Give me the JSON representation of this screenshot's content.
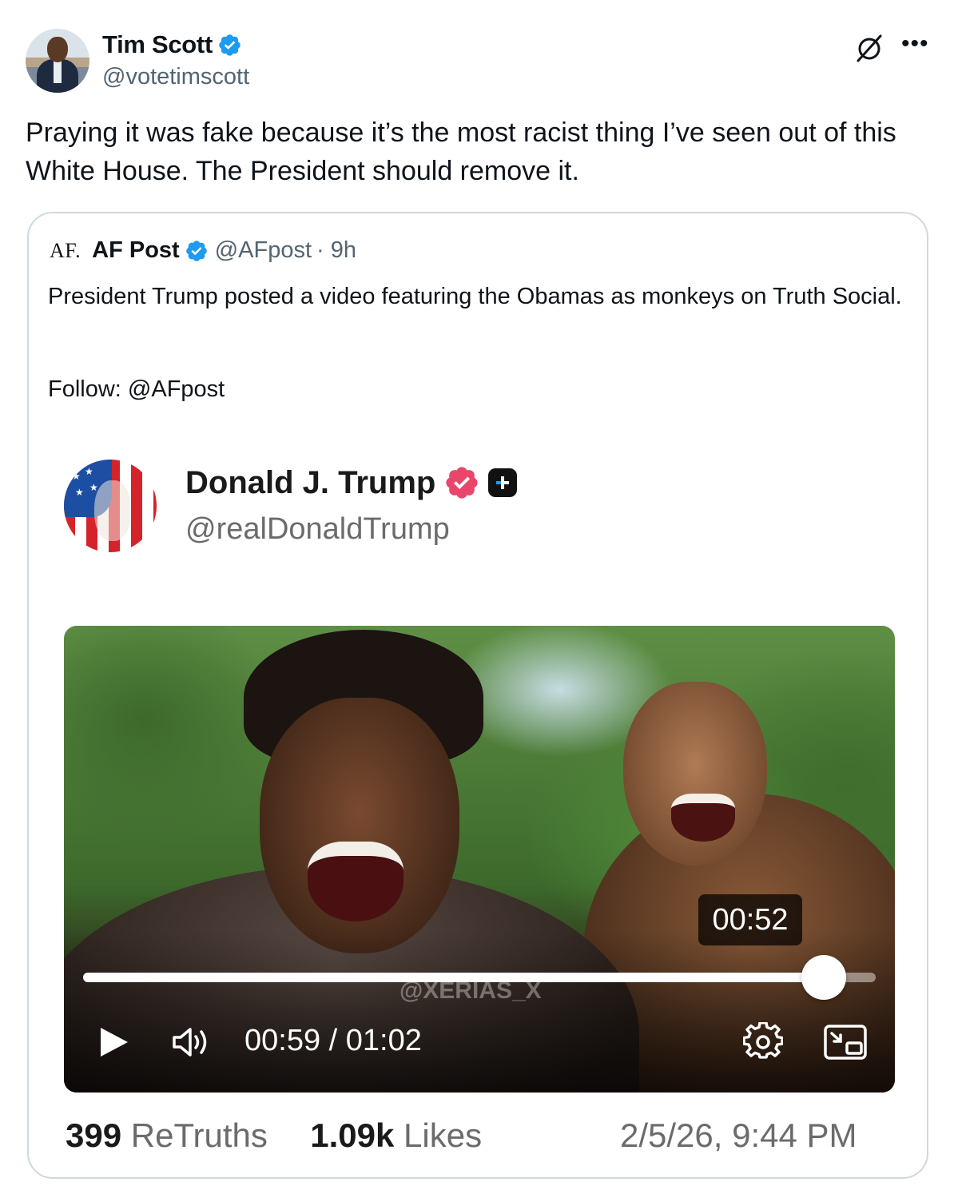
{
  "post": {
    "author_name": "Tim Scott",
    "author_handle": "@votetimscott",
    "text": "Praying it was fake because it’s the most racist thing I’ve seen out of this White House. The President should remove it."
  },
  "quoted": {
    "logo_text": "AF.",
    "name": "AF Post",
    "handle": "@AFpost",
    "time": "· 9h",
    "text": "President Trump posted a video featuring the Obamas as monkeys on Truth Social.",
    "follow": "Follow: @AFpost"
  },
  "truth": {
    "name": "Donald J. Trump",
    "handle": "@realDonaldTrump",
    "video": {
      "duration_badge": "00:52",
      "time_display": "00:59 / 01:02",
      "progress_fraction": 0.934,
      "watermark": "@XERIAS_X"
    },
    "stats": {
      "retruths_count": "399",
      "retruths_label": "ReTruths",
      "likes_count": "1.09k",
      "likes_label": "Likes",
      "date": "2/5/26, 9:44 PM"
    }
  },
  "colors": {
    "verified_blue": "#1d9bf0",
    "truth_verified_pink": "#e8466b",
    "secondary_text": "#536471",
    "border": "#cfd9de"
  },
  "icons": [
    "verified-badge-icon",
    "grok-icon",
    "more-icon",
    "truth-verified-icon",
    "truth-plus-icon",
    "play-icon",
    "volume-icon",
    "settings-icon",
    "picture-in-picture-icon"
  ]
}
